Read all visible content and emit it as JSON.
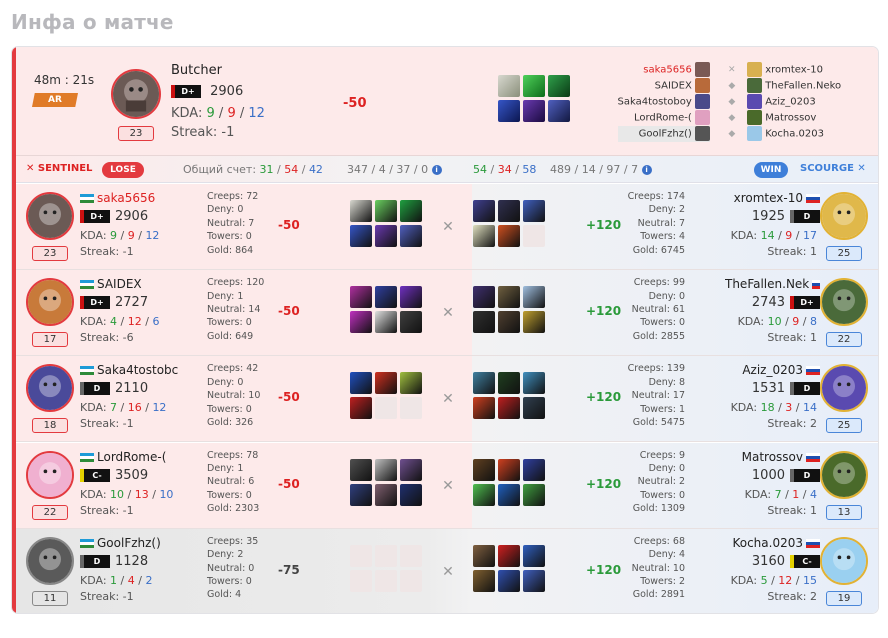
{
  "page_title": "Инфа о матче",
  "summary": {
    "duration": "48m : 21s",
    "mode": "AR",
    "player_name": "Butcher",
    "rank": "D+",
    "rating": "2906",
    "kda_label": "KDA:",
    "kda_k": "9",
    "kda_d": "9",
    "kda_a": "12",
    "streak": "Streak: -1",
    "level": "23",
    "delta": "-50",
    "sentinel_players": [
      "saka5656",
      "SAIDEX",
      "Saka4tostoboy",
      "LordRome-(",
      "GoolFzhz()"
    ],
    "scourge_players": [
      "xromtex-10",
      "TheFallen.Neko",
      "Aziz_0203",
      "Matrossov",
      "Kocha.0203"
    ]
  },
  "teambar": {
    "sentinel": "SENTINEL",
    "result_left": "LOSE",
    "score_label": "Общий счет:",
    "score_k": "31",
    "score_d": "54",
    "score_a": "42",
    "left_totals": "347 / 4 / 37 / 0",
    "right_k": "54",
    "right_d": "34",
    "right_a": "58",
    "right_totals": "489 / 14 / 97 / 7",
    "result_right": "WIN",
    "scourge": "SCOURGE"
  },
  "labels": {
    "kda": "KDA:"
  },
  "rows": [
    {
      "left": {
        "name": "saka5656",
        "rank": "D+",
        "rating": "2906",
        "k": "9",
        "d": "9",
        "a": "12",
        "streak": "Streak: -1",
        "level": "23",
        "creeps": "Creeps: 72",
        "deny": "Deny: 0",
        "neutral": "Neutral: 7",
        "towers": "Towers: 0",
        "gold": "Gold: 864",
        "delta": "-50"
      },
      "right": {
        "name": "xromtex-10",
        "rank": "D",
        "rating": "1925",
        "k": "14",
        "d": "9",
        "a": "17",
        "streak": "Streak: 1",
        "level": "25",
        "creeps": "Creeps: 174",
        "deny": "Deny: 2",
        "neutral": "Neutral: 7",
        "towers": "Towers: 4",
        "gold": "Gold: 6745",
        "delta": "+120"
      }
    },
    {
      "left": {
        "name": "SAIDEX",
        "rank": "D+",
        "rating": "2727",
        "k": "4",
        "d": "12",
        "a": "6",
        "streak": "Streak: -6",
        "level": "17",
        "creeps": "Creeps: 120",
        "deny": "Deny: 1",
        "neutral": "Neutral: 14",
        "towers": "Towers: 0",
        "gold": "Gold: 649",
        "delta": "-50"
      },
      "right": {
        "name": "TheFallen.Nek",
        "rank": "D+",
        "rating": "2743",
        "k": "10",
        "d": "9",
        "a": "8",
        "streak": "Streak: 1",
        "level": "22",
        "creeps": "Creeps: 99",
        "deny": "Deny: 0",
        "neutral": "Neutral: 61",
        "towers": "Towers: 0",
        "gold": "Gold: 2855",
        "delta": "+120"
      }
    },
    {
      "left": {
        "name": "Saka4tostobc",
        "rank": "D",
        "rating": "2110",
        "k": "7",
        "d": "16",
        "a": "12",
        "streak": "Streak: -1",
        "level": "18",
        "creeps": "Creeps: 42",
        "deny": "Deny: 0",
        "neutral": "Neutral: 10",
        "towers": "Towers: 0",
        "gold": "Gold: 326",
        "delta": "-50"
      },
      "right": {
        "name": "Aziz_0203",
        "rank": "D",
        "rating": "1531",
        "k": "18",
        "d": "3",
        "a": "14",
        "streak": "Streak: 2",
        "level": "25",
        "creeps": "Creeps: 139",
        "deny": "Deny: 8",
        "neutral": "Neutral: 17",
        "towers": "Towers: 1",
        "gold": "Gold: 5475",
        "delta": "+120"
      }
    },
    {
      "left": {
        "name": "LordRome-(",
        "rank": "C-",
        "rating": "3509",
        "k": "10",
        "d": "13",
        "a": "10",
        "streak": "Streak: -1",
        "level": "22",
        "creeps": "Creeps: 78",
        "deny": "Deny: 1",
        "neutral": "Neutral: 6",
        "towers": "Towers: 0",
        "gold": "Gold: 2303",
        "delta": "-50"
      },
      "right": {
        "name": "Matrossov",
        "rank": "D",
        "rating": "1000",
        "k": "7",
        "d": "1",
        "a": "4",
        "streak": "Streak: 1",
        "level": "13",
        "creeps": "Creeps: 9",
        "deny": "Deny: 0",
        "neutral": "Neutral: 2",
        "towers": "Towers: 0",
        "gold": "Gold: 1309",
        "delta": "+120"
      }
    },
    {
      "left": {
        "name": "GoolFzhz()",
        "rank": "D",
        "rating": "1128",
        "k": "1",
        "d": "4",
        "a": "2",
        "streak": "Streak: -1",
        "level": "11",
        "creeps": "Creeps: 35",
        "deny": "Deny: 2",
        "neutral": "Neutral: 0",
        "towers": "Towers: 0",
        "gold": "Gold: 4",
        "delta": "-75"
      },
      "right": {
        "name": "Kocha.0203",
        "rank": "C-",
        "rating": "3160",
        "k": "5",
        "d": "12",
        "a": "15",
        "streak": "Streak: 2",
        "level": "19",
        "creeps": "Creeps: 68",
        "deny": "Deny: 4",
        "neutral": "Neutral: 10",
        "towers": "Towers: 2",
        "gold": "Gold: 2891",
        "delta": "+120"
      }
    }
  ],
  "colors": {
    "loss_red": "#e33a3f",
    "win_blue": "#3e7fd9",
    "gain_green": "#2a9a3a"
  }
}
